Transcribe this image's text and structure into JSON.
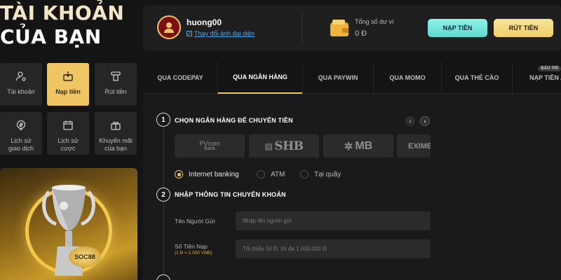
{
  "page_title": {
    "line1": "TÀI KHOẢN",
    "line2": "CỦA BẠN"
  },
  "menu": [
    {
      "label": "Tài khoản",
      "icon": "user-settings-icon",
      "active": false
    },
    {
      "label": "Nạp tiền",
      "icon": "deposit-icon",
      "active": true
    },
    {
      "label": "Rút tiền",
      "icon": "withdraw-icon",
      "active": false
    },
    {
      "label": "Lịch sử\ngiao dịch",
      "icon": "dollar-history-icon",
      "active": false
    },
    {
      "label": "Lịch sử\ncược",
      "icon": "calendar-icon",
      "active": false
    },
    {
      "label": "Khuyến mãi\ncủa bạn",
      "icon": "gift-icon",
      "active": false
    }
  ],
  "promo": {
    "coin_text": "SOC88"
  },
  "header": {
    "username": "huong00",
    "change_avatar": "Thay đổi ảnh đại diện",
    "balance_label": "Tổng số dư ví",
    "balance_value": "0 Đ",
    "deposit_button": "NẠP TIỀN",
    "withdraw_button": "RÚT TIỀN"
  },
  "tabs": [
    {
      "label": "QUA CODEPAY",
      "active": false
    },
    {
      "label": "QUA NGÂN HÀNG",
      "active": true
    },
    {
      "label": "QUA PAYWIN",
      "active": false
    },
    {
      "label": "QUA MOMO",
      "active": false
    },
    {
      "label": "QUA THẺ CÀO",
      "active": false
    },
    {
      "label": "NẠP TIỀN A",
      "active": false,
      "badge": "BẢO TRÌ"
    }
  ],
  "step1": {
    "number": "1",
    "title": "CHỌN NGÂN HÀNG ĐỂ CHUYỂN TIỀN",
    "banks": [
      {
        "name": "PVcom Bank",
        "line1": "PVcom",
        "line2": "Bank"
      },
      {
        "name": "SHB"
      },
      {
        "name": "MB"
      },
      {
        "name": "EXIMB"
      }
    ],
    "methods": [
      {
        "label": "Internet banking",
        "selected": true
      },
      {
        "label": "ATM",
        "selected": false
      },
      {
        "label": "Tại quầy",
        "selected": false
      }
    ]
  },
  "step2": {
    "number": "2",
    "title": "NHẬP THÔNG TIN CHUYỂN KHOẢN",
    "sender_label": "Tên Người Gửi",
    "sender_placeholder": "Nhập tên người gửi",
    "amount_label": "Số Tiền Nạp",
    "amount_note": "(1 Đ = 1.000 VNĐ)",
    "amount_placeholder": "Tối thiểu 50 Đ, tối đa 1.000.000 Đ"
  },
  "colors": {
    "accent_gold": "#f0c564",
    "accent_teal": "#6fe3d9",
    "background": "#141414",
    "panel": "#1f1f1f"
  }
}
